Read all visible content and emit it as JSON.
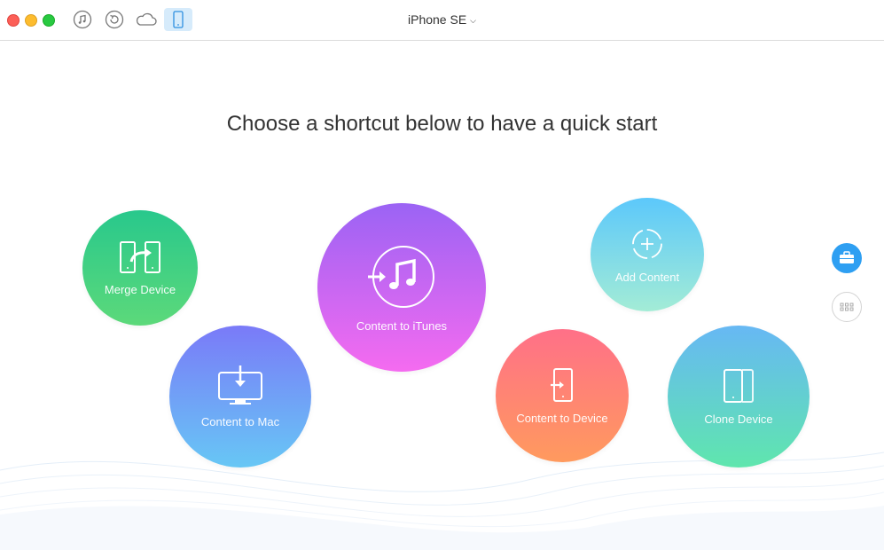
{
  "window": {
    "device_name": "iPhone SE",
    "toolbar_icons": [
      "music-note-icon",
      "backup-restore-icon",
      "icloud-icon",
      "iphone-icon"
    ],
    "active_toolbar_icon": "iphone-icon"
  },
  "main": {
    "headline": "Choose a shortcut below to have a quick start",
    "shortcuts": [
      {
        "label": "Merge Device",
        "icon": "merge-device-icon",
        "colors": [
          "#28c88c",
          "#5cd97a"
        ]
      },
      {
        "label": "Content to Mac",
        "icon": "monitor-download-icon",
        "colors": [
          "#7a7af8",
          "#67c7f5"
        ]
      },
      {
        "label": "Content to iTunes",
        "icon": "itunes-note-icon",
        "colors": [
          "#9b63f4",
          "#f56bf0"
        ]
      },
      {
        "label": "Add Content",
        "icon": "add-circle-icon",
        "colors": [
          "#5cc8fb",
          "#a3ecd6"
        ]
      },
      {
        "label": "Content to Device",
        "icon": "phone-import-icon",
        "colors": [
          "#ff7088",
          "#ff9a5e"
        ]
      },
      {
        "label": "Clone Device",
        "icon": "clone-device-icon",
        "colors": [
          "#67b8f4",
          "#5fe6ad"
        ]
      }
    ]
  },
  "sidebar_buttons": [
    {
      "icon": "toolbox-icon",
      "active": true,
      "color": "#2e9ff2"
    },
    {
      "icon": "app-grid-icon",
      "active": false
    }
  ]
}
